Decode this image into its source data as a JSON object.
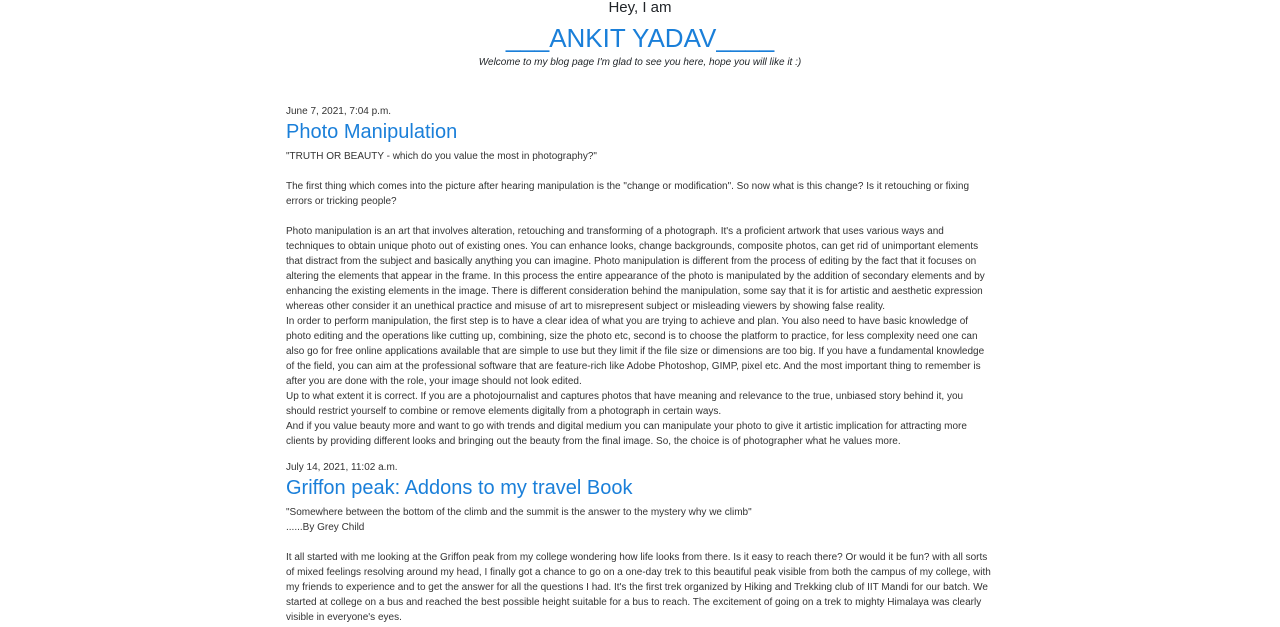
{
  "header": {
    "greeting": "Hey, I am",
    "name": "___ANKIT YADAV____",
    "tagline": "Welcome to my blog page I'm glad to see you here, hope you will like it :)"
  },
  "posts": [
    {
      "date": "June 7, 2021, 7:04 p.m.",
      "title": "Photo Manipulation",
      "paragraphs": [
        "\"TRUTH OR BEAUTY - which do you value the most in photography?\"",
        "The first thing which comes into the picture after hearing manipulation is the \"change or modification\". So now what is this change? Is it retouching or fixing errors or tricking people?",
        "Photo manipulation is an art that involves alteration, retouching and transforming of a photograph. It's a proficient artwork that uses various ways and techniques to obtain unique photo out of existing ones. You can enhance looks, change backgrounds, composite photos, can get rid of unimportant elements that distract from the subject and basically anything you can imagine. Photo manipulation is different from the process of editing by the fact that it focuses on altering the elements that appear in the frame. In this process the entire appearance of the photo is manipulated by the addition of secondary elements and by enhancing the existing elements in the image. There is different consideration behind the manipulation, some say that it is for artistic and aesthetic expression whereas other consider it an unethical practice and misuse of art to misrepresent subject or misleading viewers by showing false reality.",
        "In order to perform manipulation, the first step is to have a clear idea of what you are trying to achieve and plan. You also need to have basic knowledge of photo editing and the operations like cutting up, combining, size the photo etc, second is to choose the platform to practice, for less complexity need one can also go for free online applications available that are simple to use but they limit if the file size or dimensions are too big. If you have a fundamental knowledge of the field, you can aim at the professional software that are feature-rich like Adobe Photoshop, GIMP, pixel etc. And the most important thing to remember is after you are done with the role, your image should not look edited.",
        "Up to what extent it is correct. If you are a photojournalist and captures photos that have meaning and relevance to the true, unbiased story behind it, you should restrict yourself to combine or remove elements digitally from a photograph in certain ways.",
        "And if you value beauty more and want to go with trends and digital medium you can manipulate your photo to give it artistic implication for attracting more clients by providing different looks and bringing out the beauty from the final image. So, the choice is of photographer what he values more."
      ]
    },
    {
      "date": "July 14, 2021, 11:02 a.m.",
      "title": "Griffon peak: Addons to my travel Book",
      "paragraphs": [
        "\"Somewhere between the bottom of the climb and the summit is the answer to the mystery why we climb\"",
        "......By Grey Child",
        "It all started with me looking at the Griffon peak from my college wondering how life looks from there. Is it easy to reach there? Or would it be fun? with all sorts of mixed feelings resolving around my head, I finally got a chance to go on a one-day trek to this beautiful peak visible from both the campus of my college, with my friends to experience and to get the answer for all the questions I had. It's the first trek organized by Hiking and Trekking club of IIT Mandi for our batch. We started at college on a bus and reached the best possible height suitable for a bus to reach. The excitement of going on a trek to mighty Himalaya was clearly visible in everyone's eyes."
      ]
    }
  ]
}
